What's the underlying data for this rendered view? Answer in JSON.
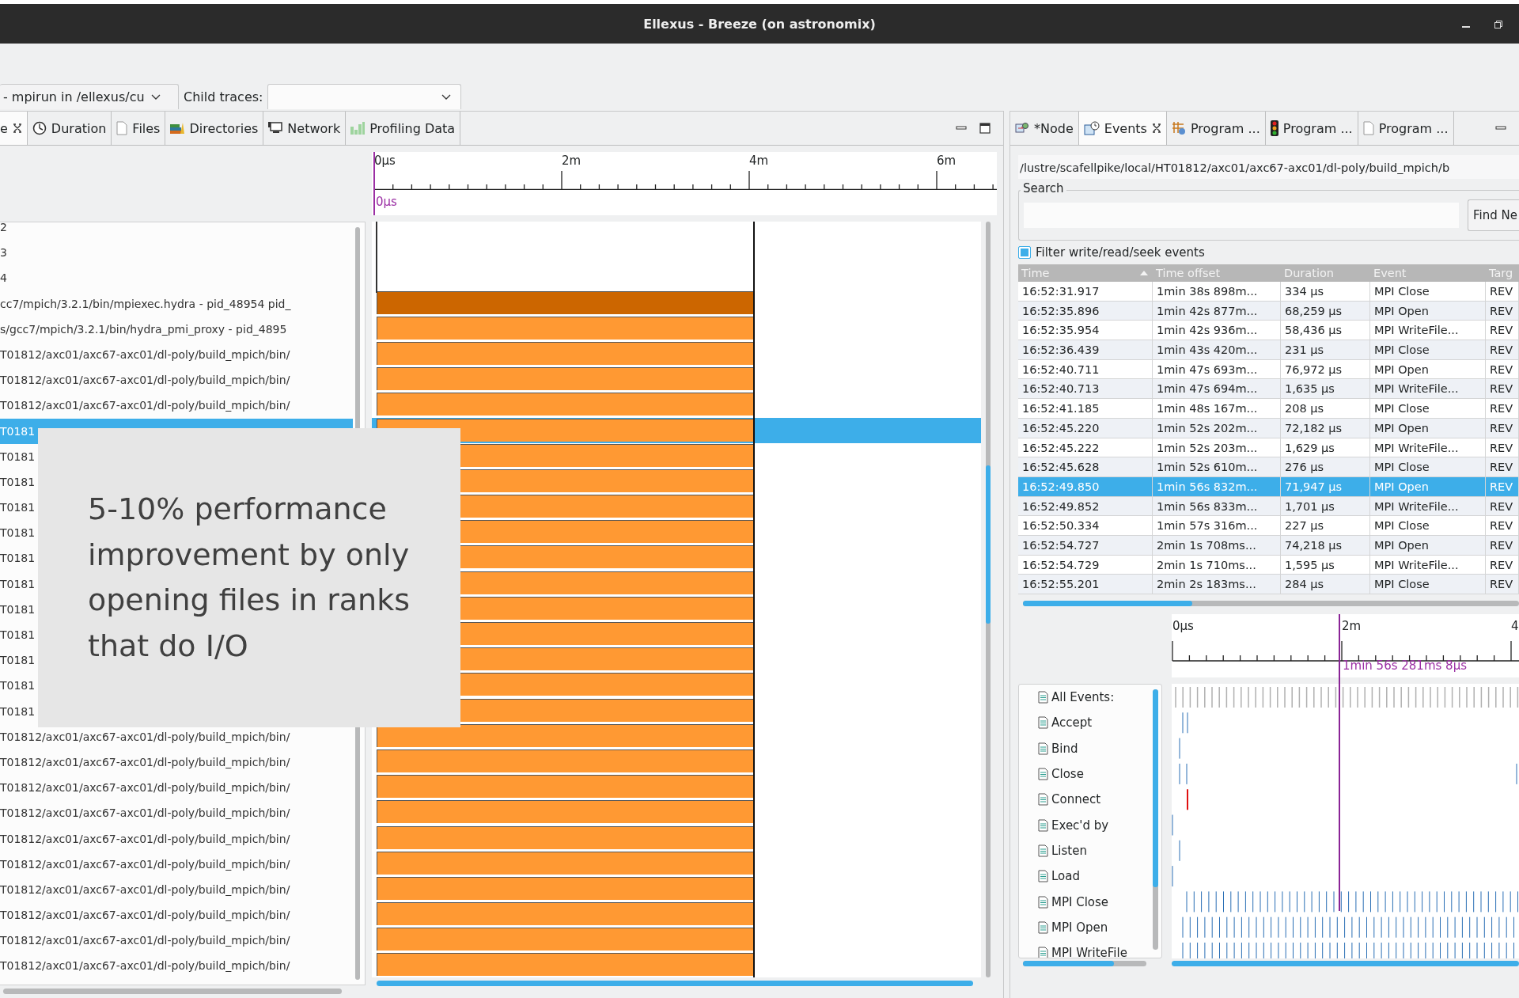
{
  "window": {
    "title": "Ellexus - Breeze  (on astronomix)"
  },
  "toolbar": {
    "trace_selector": {
      "value": "- mpirun in /ellexus/cu"
    },
    "child_traces": {
      "label": "Child traces:"
    }
  },
  "left_view": {
    "tabs": [
      {
        "label": "e",
        "selected": true,
        "closable": true
      },
      {
        "label": "Duration",
        "selected": false,
        "closable": false
      },
      {
        "label": "Files",
        "selected": false,
        "closable": false
      },
      {
        "label": "Directories",
        "selected": false,
        "closable": false
      },
      {
        "label": "Network",
        "selected": false,
        "closable": false
      },
      {
        "label": "Profiling Data",
        "selected": false,
        "closable": false
      }
    ],
    "timeline": {
      "ticks": [
        "0μs",
        "2m",
        "4m",
        "6m"
      ],
      "cursor": "0μs"
    },
    "rows": [
      {
        "label": "2",
        "kind": "empty",
        "selected": false
      },
      {
        "label": "3",
        "kind": "empty",
        "selected": false
      },
      {
        "label": "4",
        "kind": "empty",
        "selected": false
      },
      {
        "label": "cc7/mpich/3.2.1/bin/mpiexec.hydra - pid_48954 pid_",
        "kind": "parent",
        "selected": false
      },
      {
        "label": "s/gcc7/mpich/3.2.1/bin/hydra_pmi_proxy - pid_4895",
        "kind": "child",
        "selected": false
      },
      {
        "label": "T01812/axc01/axc67-axc01/dl-poly/build_mpich/bin/",
        "kind": "child",
        "selected": false
      },
      {
        "label": "T01812/axc01/axc67-axc01/dl-poly/build_mpich/bin/",
        "kind": "child",
        "selected": false
      },
      {
        "label": "T01812/axc01/axc67-axc01/dl-poly/build_mpich/bin/",
        "kind": "child",
        "selected": false
      },
      {
        "label": "T0181",
        "kind": "child",
        "selected": true
      },
      {
        "label": "T0181",
        "kind": "child",
        "selected": false
      },
      {
        "label": "T0181",
        "kind": "child",
        "selected": false
      },
      {
        "label": "T0181",
        "kind": "child",
        "selected": false
      },
      {
        "label": "T0181",
        "kind": "child",
        "selected": false
      },
      {
        "label": "T0181",
        "kind": "child",
        "selected": false
      },
      {
        "label": "T0181",
        "kind": "child",
        "selected": false
      },
      {
        "label": "T0181",
        "kind": "child",
        "selected": false
      },
      {
        "label": "T0181",
        "kind": "child",
        "selected": false
      },
      {
        "label": "T0181",
        "kind": "child",
        "selected": false
      },
      {
        "label": "T0181",
        "kind": "child",
        "selected": false
      },
      {
        "label": "T0181",
        "kind": "child",
        "selected": false
      },
      {
        "label": "T01812/axc01/axc67-axc01/dl-poly/build_mpich/bin/",
        "kind": "child",
        "selected": false
      },
      {
        "label": "T01812/axc01/axc67-axc01/dl-poly/build_mpich/bin/",
        "kind": "child",
        "selected": false
      },
      {
        "label": "T01812/axc01/axc67-axc01/dl-poly/build_mpich/bin/",
        "kind": "child",
        "selected": false
      },
      {
        "label": "T01812/axc01/axc67-axc01/dl-poly/build_mpich/bin/",
        "kind": "child",
        "selected": false
      },
      {
        "label": "T01812/axc01/axc67-axc01/dl-poly/build_mpich/bin/",
        "kind": "child",
        "selected": false
      },
      {
        "label": "T01812/axc01/axc67-axc01/dl-poly/build_mpich/bin/",
        "kind": "child",
        "selected": false
      },
      {
        "label": "T01812/axc01/axc67-axc01/dl-poly/build_mpich/bin/",
        "kind": "child",
        "selected": false
      },
      {
        "label": "T01812/axc01/axc67-axc01/dl-poly/build_mpich/bin/",
        "kind": "child",
        "selected": false
      },
      {
        "label": "T01812/axc01/axc67-axc01/dl-poly/build_mpich/bin/",
        "kind": "child",
        "selected": false
      },
      {
        "label": "T01812/axc01/axc67-axc01/dl-poly/build_mpich/bin/",
        "kind": "child",
        "selected": false
      }
    ]
  },
  "callout": {
    "text": "5-10% performance improvement by only opening files in ranks that do I/O"
  },
  "right_view": {
    "tabs": [
      {
        "label": "*Node",
        "selected": false,
        "closable": false
      },
      {
        "label": "Events",
        "selected": true,
        "closable": true
      },
      {
        "label": "Program ...",
        "selected": false,
        "closable": false
      },
      {
        "label": "Program ...",
        "selected": false,
        "closable": false
      },
      {
        "label": "Program ...",
        "selected": false,
        "closable": false
      }
    ],
    "path": "/lustre/scafellpike/local/HT01812/axc01/axc67-axc01/dl-poly/build_mpich/b",
    "search": {
      "label": "Search",
      "button": "Find Ne"
    },
    "filter": {
      "label": "Filter write/read/seek events",
      "checked": true
    },
    "table": {
      "columns": [
        {
          "label": "Time",
          "sorted": true
        },
        {
          "label": "Time offset",
          "sorted": false
        },
        {
          "label": "Duration",
          "sorted": false
        },
        {
          "label": "Event",
          "sorted": false
        },
        {
          "label": "Targ",
          "sorted": false
        }
      ],
      "rows": [
        {
          "cells": [
            "16:52:31.917",
            "1min 38s 898m...",
            "334 μs",
            "MPI Close",
            "REV"
          ],
          "selected": false
        },
        {
          "cells": [
            "16:52:35.896",
            "1min 42s 877m...",
            "68,259 μs",
            "MPI Open",
            "REV"
          ],
          "selected": false
        },
        {
          "cells": [
            "16:52:35.954",
            "1min 42s 936m...",
            "58,436 μs",
            "MPI WriteFile...",
            "REV"
          ],
          "selected": false
        },
        {
          "cells": [
            "16:52:36.439",
            "1min 43s 420m...",
            "231 μs",
            "MPI Close",
            "REV"
          ],
          "selected": false
        },
        {
          "cells": [
            "16:52:40.711",
            "1min 47s 693m...",
            "76,972 μs",
            "MPI Open",
            "REV"
          ],
          "selected": false
        },
        {
          "cells": [
            "16:52:40.713",
            "1min 47s 694m...",
            "1,635 μs",
            "MPI WriteFile...",
            "REV"
          ],
          "selected": false
        },
        {
          "cells": [
            "16:52:41.185",
            "1min 48s 167m...",
            "208 μs",
            "MPI Close",
            "REV"
          ],
          "selected": false
        },
        {
          "cells": [
            "16:52:45.220",
            "1min 52s 202m...",
            "72,182 μs",
            "MPI Open",
            "REV"
          ],
          "selected": false
        },
        {
          "cells": [
            "16:52:45.222",
            "1min 52s 203m...",
            "1,629 μs",
            "MPI WriteFile...",
            "REV"
          ],
          "selected": false
        },
        {
          "cells": [
            "16:52:45.628",
            "1min 52s 610m...",
            "276 μs",
            "MPI Close",
            "REV"
          ],
          "selected": false
        },
        {
          "cells": [
            "16:52:49.850",
            "1min 56s 832m...",
            "71,947 μs",
            "MPI Open",
            "REV"
          ],
          "selected": true
        },
        {
          "cells": [
            "16:52:49.852",
            "1min 56s 833m...",
            "1,701 μs",
            "MPI WriteFile...",
            "REV"
          ],
          "selected": false
        },
        {
          "cells": [
            "16:52:50.334",
            "1min 57s 316m...",
            "227 μs",
            "MPI Close",
            "REV"
          ],
          "selected": false
        },
        {
          "cells": [
            "16:52:54.727",
            "2min 1s 708ms...",
            "74,218 μs",
            "MPI Open",
            "REV"
          ],
          "selected": false
        },
        {
          "cells": [
            "16:52:54.729",
            "2min 1s 710ms...",
            "1,595 μs",
            "MPI WriteFile...",
            "REV"
          ],
          "selected": false
        },
        {
          "cells": [
            "16:52:55.201",
            "2min 2s 183ms...",
            "284 μs",
            "MPI Close",
            "REV"
          ],
          "selected": false
        }
      ]
    },
    "event_timeline": {
      "ticks": [
        "0μs",
        "2m",
        "4"
      ],
      "cursor": "1min 56s 281ms 8μs",
      "events": [
        "All Events:",
        "Accept",
        "Bind",
        "Close",
        "Connect",
        "Exec'd by",
        "Listen",
        "Load",
        "MPI Close",
        "MPI Open",
        "MPI WriteFile"
      ]
    }
  }
}
